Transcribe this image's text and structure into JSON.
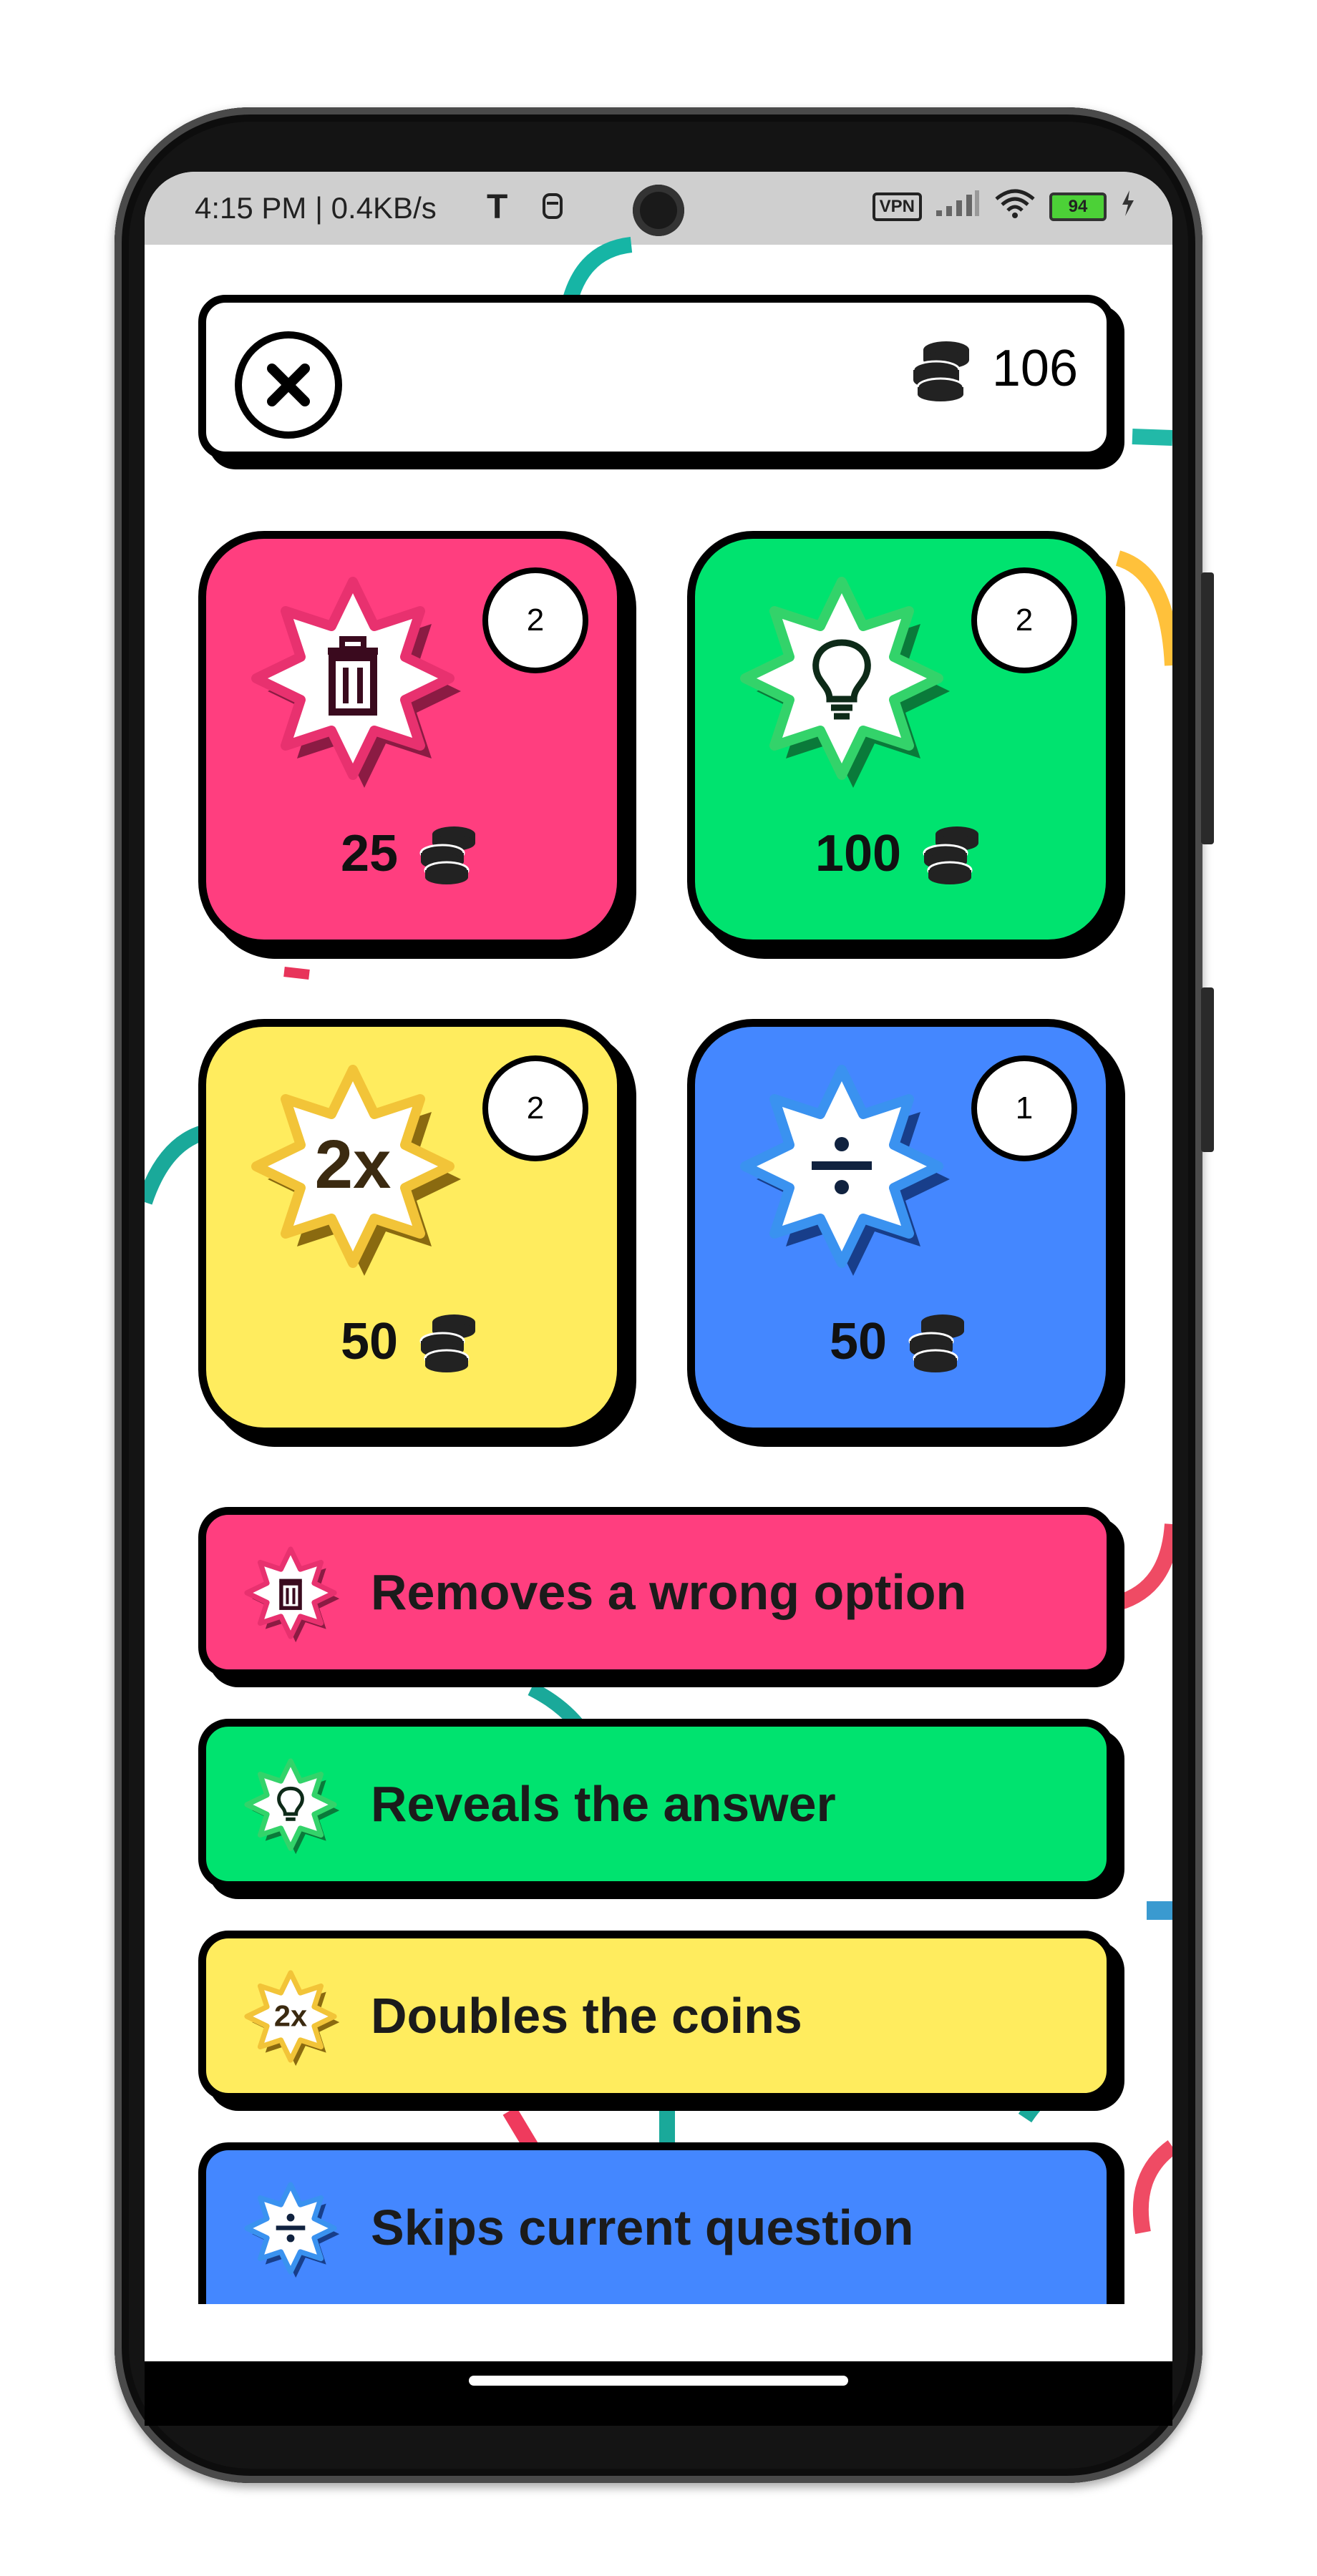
{
  "status_bar": {
    "time": "4:15 PM | 0.4KB/s",
    "t_icon": "T",
    "misc_icon": "notification-icon",
    "vpn": "VPN",
    "signal_icon": "signal-icon",
    "wifi_icon": "wifi-icon",
    "battery": "94",
    "charging_icon": "charging-icon"
  },
  "header": {
    "close_icon": "close-icon",
    "coin_icon": "coins-icon",
    "coins": "106"
  },
  "powerups": [
    {
      "id": "remove",
      "icon": "trash-icon",
      "count": "2",
      "price": "25",
      "color": "#ff3e7f",
      "star_border": "#e8316f"
    },
    {
      "id": "reveal",
      "icon": "lightbulb-icon",
      "count": "2",
      "price": "100",
      "color": "#00e36f",
      "star_border": "#33d36a"
    },
    {
      "id": "double",
      "icon": "2x",
      "count": "2",
      "price": "50",
      "color": "#ffec5e",
      "star_border": "#f2c438"
    },
    {
      "id": "skip",
      "icon": "divide-icon",
      "count": "1",
      "price": "50",
      "color": "#4487ff",
      "star_border": "#3a92f0"
    }
  ],
  "descriptions": [
    {
      "text": "Removes a wrong option",
      "color": "#ff3e7f"
    },
    {
      "text": "Reveals the answer",
      "color": "#00e36f"
    },
    {
      "text": "Doubles the coins",
      "color": "#ffec5e"
    },
    {
      "text": "Skips current question",
      "color": "#4487ff"
    }
  ]
}
